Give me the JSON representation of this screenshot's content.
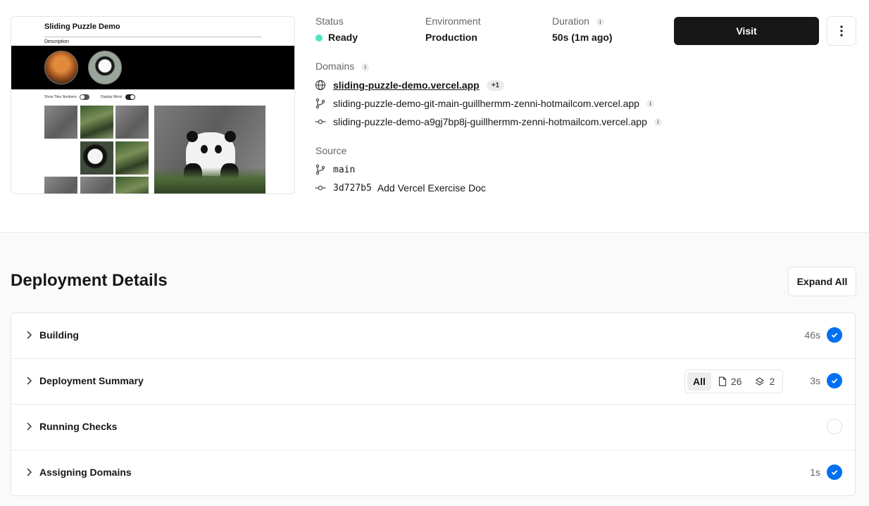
{
  "preview": {
    "title": "Sliding Puzzle Demo",
    "description": "Description",
    "toggle_numbers_label": "Show Tiles Numbers",
    "toggle_mirror_label": "Display Mirror"
  },
  "status": {
    "label": "Status",
    "value": "Ready",
    "color": "#50e3c2"
  },
  "environment": {
    "label": "Environment",
    "value": "Production"
  },
  "duration": {
    "label": "Duration",
    "value": "50s (1m ago)"
  },
  "actions": {
    "visit_label": "Visit",
    "more_icon": "more-vertical-icon"
  },
  "domains": {
    "label": "Domains",
    "items": [
      {
        "icon": "globe-icon",
        "text": "sliding-puzzle-demo.vercel.app",
        "badge": "+1"
      },
      {
        "icon": "git-branch-icon",
        "text": "sliding-puzzle-demo-git-main-guillhermm-zenni-hotmailcom.vercel.app"
      },
      {
        "icon": "git-commit-icon",
        "text": "sliding-puzzle-demo-a9gj7bp8j-guillhermm-zenni-hotmailcom.vercel.app"
      }
    ]
  },
  "source": {
    "label": "Source",
    "branch": "main",
    "commit_hash": "3d727b5",
    "commit_message": "Add Vercel Exercise Doc"
  },
  "details": {
    "title": "Deployment Details",
    "expand_label": "Expand All",
    "accent": "#0070f3",
    "steps": [
      {
        "name": "Building",
        "time": "46s",
        "state": "done"
      },
      {
        "name": "Deployment Summary",
        "time": "3s",
        "state": "done",
        "filter": {
          "all_label": "All",
          "files_count": "26",
          "functions_count": "2"
        }
      },
      {
        "name": "Running Checks",
        "time": "",
        "state": "pending"
      },
      {
        "name": "Assigning Domains",
        "time": "1s",
        "state": "done"
      }
    ]
  }
}
